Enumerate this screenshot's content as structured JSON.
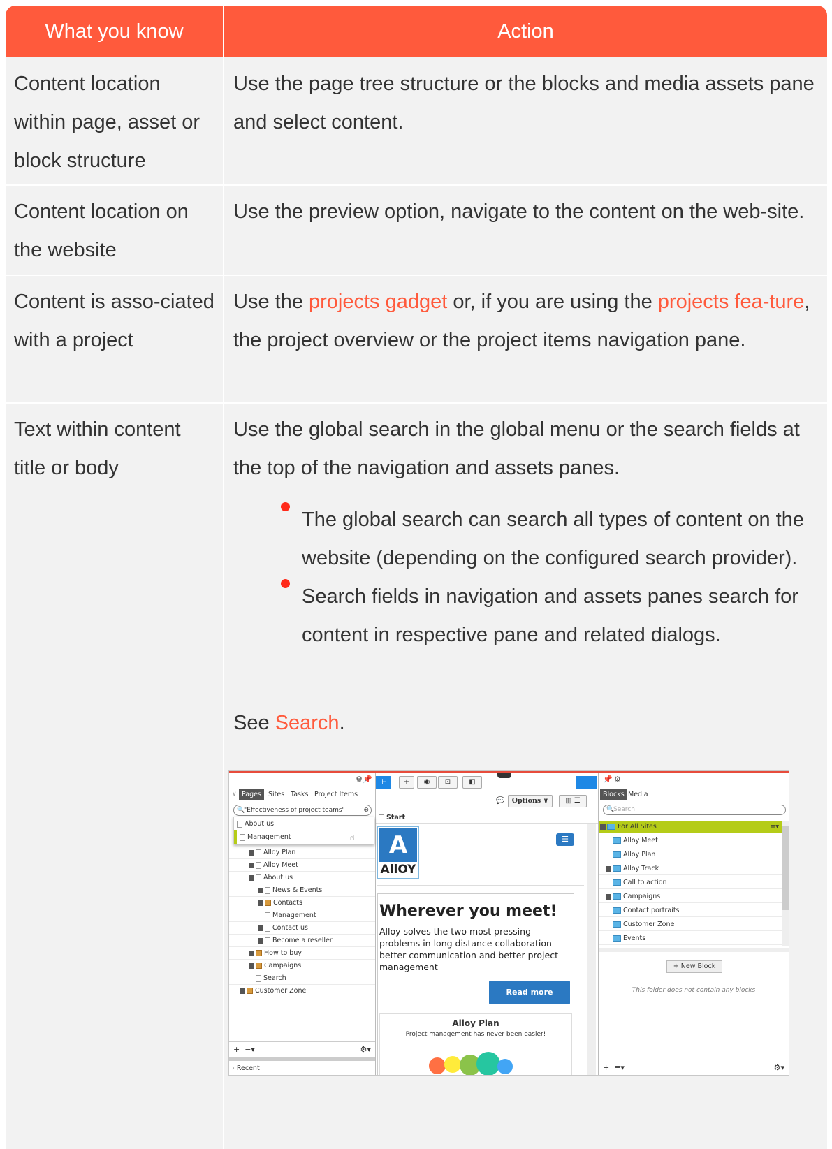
{
  "header": {
    "col1": "What you know",
    "col2": "Action"
  },
  "rows": [
    {
      "know": "Content location within page, asset or block structure",
      "action": "Use the page tree structure or the blocks and media assets pane and select content."
    },
    {
      "know": "Content location on the website",
      "action": "Use the preview option, navigate to the content on the web-site."
    },
    {
      "know": "Content is asso-ciated with a project",
      "action_pre": "Use the ",
      "link1": "projects gadget",
      "action_mid": " or, if you are using the ",
      "link2": "projects fea-ture",
      "action_post": ", the project overview or the project items navigation pane."
    },
    {
      "know": "Text within content title or body",
      "action": "Use the global search in the global menu or the search fields at the top of the navigation and assets panes.",
      "bullets": [
        "The global search can search all types of content on the website (depending on the configured search provider).",
        "Search fields in navigation and assets panes search for content in respective pane and related dialogs."
      ],
      "see_pre": "See ",
      "see_link": "Search",
      "see_post": "."
    }
  ],
  "screenshot": {
    "left_tabs": [
      "Pages",
      "Sites",
      "Tasks",
      "Project Items"
    ],
    "search_value": "\"Effectiveness of project teams\"",
    "results": [
      "About us",
      "Management"
    ],
    "tree": [
      "Alloy Plan",
      "Alloy Meet",
      "About us",
      "News & Events",
      "Contacts",
      "Management",
      "Contact us",
      "Become a reseller",
      "How to buy",
      "Campaigns",
      "Search",
      "Customer Zone"
    ],
    "recent": "Recent",
    "options": "Options",
    "start": "Start",
    "logo": "A",
    "logo_word": "AllOY",
    "hero_title": "Wherever you meet!",
    "hero_text": "Alloy solves the two most pressing problems in long distance collaboration – better communication and better project management",
    "read_more": "Read more",
    "plan_title": "Alloy Plan",
    "plan_text": "Project management has never been easier!",
    "right_tabs": [
      "Blocks",
      "Media"
    ],
    "right_search": "Search",
    "folders": [
      "For All Sites",
      "Alloy Meet",
      "Alloy Plan",
      "Alloy Track",
      "Call to action",
      "Campaigns",
      "Contact portraits",
      "Customer Zone",
      "Events"
    ],
    "new_block": "+ New Block",
    "empty_msg": "This folder does not contain any blocks"
  }
}
